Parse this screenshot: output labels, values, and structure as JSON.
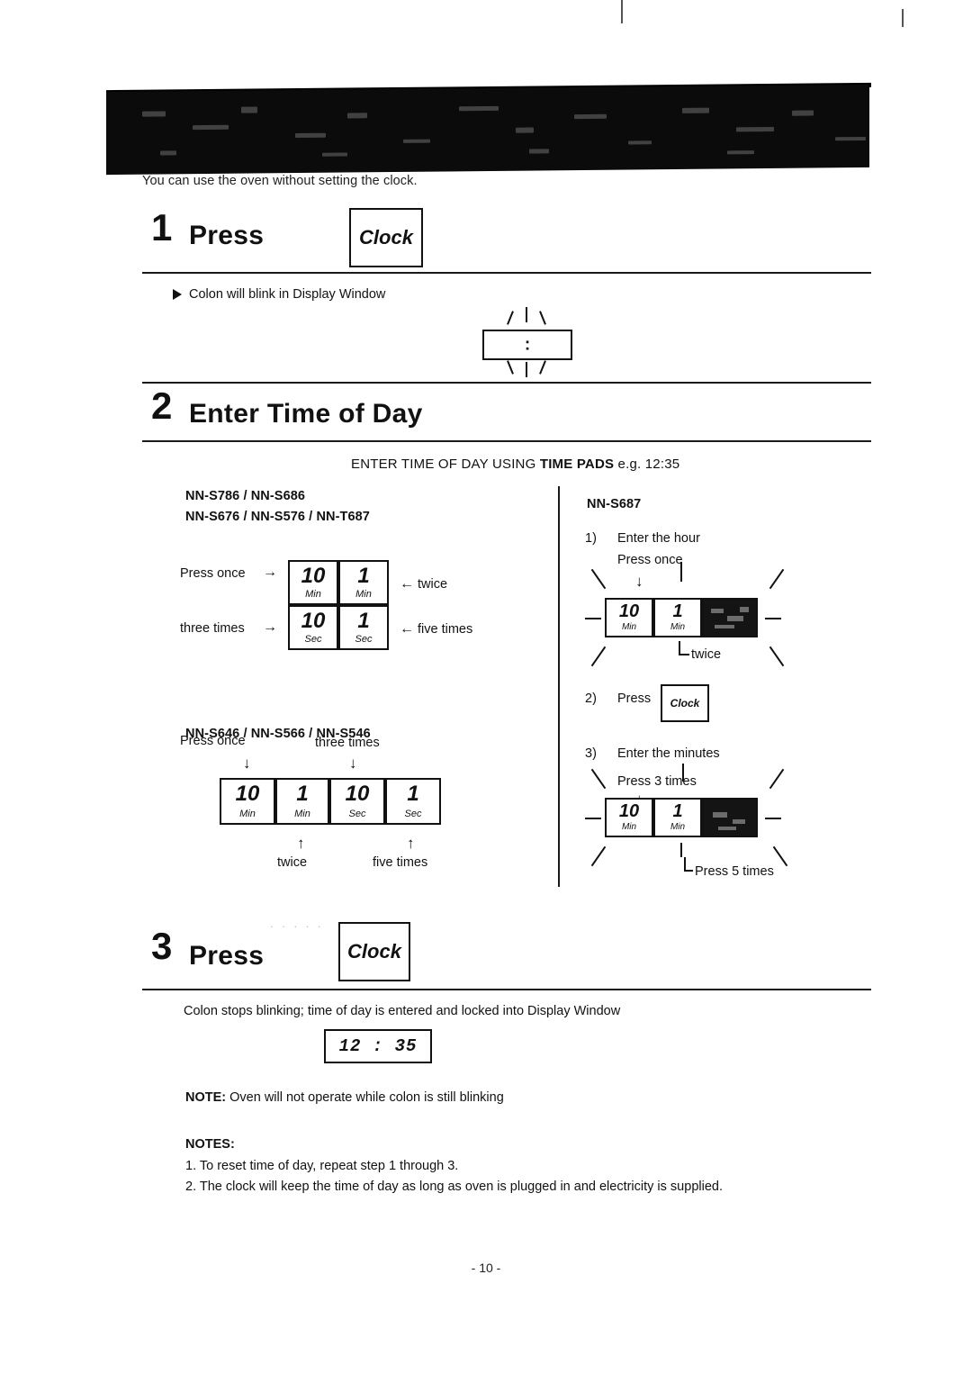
{
  "intro": "You can use the oven without setting the clock.",
  "steps": {
    "one": {
      "number": "1",
      "title": "Press",
      "key_label": "Clock",
      "bullet": "Colon will blink in Display Window",
      "display_colon": ":"
    },
    "two": {
      "number": "2",
      "title": "Enter Time of Day",
      "instruction_prefix": "ENTER TIME OF DAY USING ",
      "instruction_bold": "TIME PADS",
      "instruction_suffix": " e.g. 12:35"
    },
    "three": {
      "number": "3",
      "title": "Press",
      "key_label": "Clock",
      "caption": "Colon stops blinking; time of day is entered  and locked into Display Window",
      "display_value": "12 : 35"
    }
  },
  "left_column": {
    "model_line1": "NN-S786 / NN-S686",
    "model_line2": "NN-S676 / NN-S576 / NN-T687",
    "row1_left_text": "Press once",
    "row1_left_arrow": "→",
    "row1_right_arrow": "←",
    "row1_right_text": "twice",
    "row2_left_text": "three times",
    "row2_left_arrow": "→",
    "row2_right_arrow": "←",
    "row2_right_text": "five times",
    "pads_a": [
      {
        "big": "10",
        "small": "Min"
      },
      {
        "big": "1",
        "small": "Min"
      },
      {
        "big": "10",
        "small": "Sec"
      },
      {
        "big": "1",
        "small": "Sec"
      }
    ],
    "model2": "NN-S646 / NN-S566 / NN-S546",
    "top_label_1": "Press once",
    "top_label_2": "three times",
    "bottom_label_1": "twice",
    "bottom_label_2": "five times",
    "down_arrow": "↓",
    "up_arrow": "↑",
    "pads_b": [
      {
        "big": "10",
        "small": "Min"
      },
      {
        "big": "1",
        "small": "Min"
      },
      {
        "big": "10",
        "small": "Sec"
      },
      {
        "big": "1",
        "small": "Sec"
      }
    ]
  },
  "right_column": {
    "model": "NN-S687",
    "step1_num": "1)",
    "step1_text": "Enter the hour",
    "step1_sub": "Press once",
    "step1_down": "↓",
    "step1_twice": "twice",
    "step1_pads": [
      {
        "big": "10",
        "small": "Min"
      },
      {
        "big": "1",
        "small": "Min"
      }
    ],
    "step2_num": "2)",
    "step2_text": "Press",
    "step2_key": "Clock",
    "step3_num": "3)",
    "step3_text": "Enter the minutes",
    "step3_sub": "Press 3 times",
    "step3_down": "↓",
    "step3_press5": "Press 5 times",
    "step3_pads": [
      {
        "big": "10",
        "small": "Min"
      },
      {
        "big": "1",
        "small": "Min"
      }
    ]
  },
  "notes": {
    "single_note_label": "NOTE:",
    "single_note_text": " Oven will not operate while colon is still blinking",
    "heading": "NOTES:",
    "items": [
      "1. To reset time of day, repeat step 1 through 3.",
      "2. The clock will keep the time of day as long as oven is plugged in and electricity is supplied."
    ]
  },
  "footer": "- 10 -"
}
